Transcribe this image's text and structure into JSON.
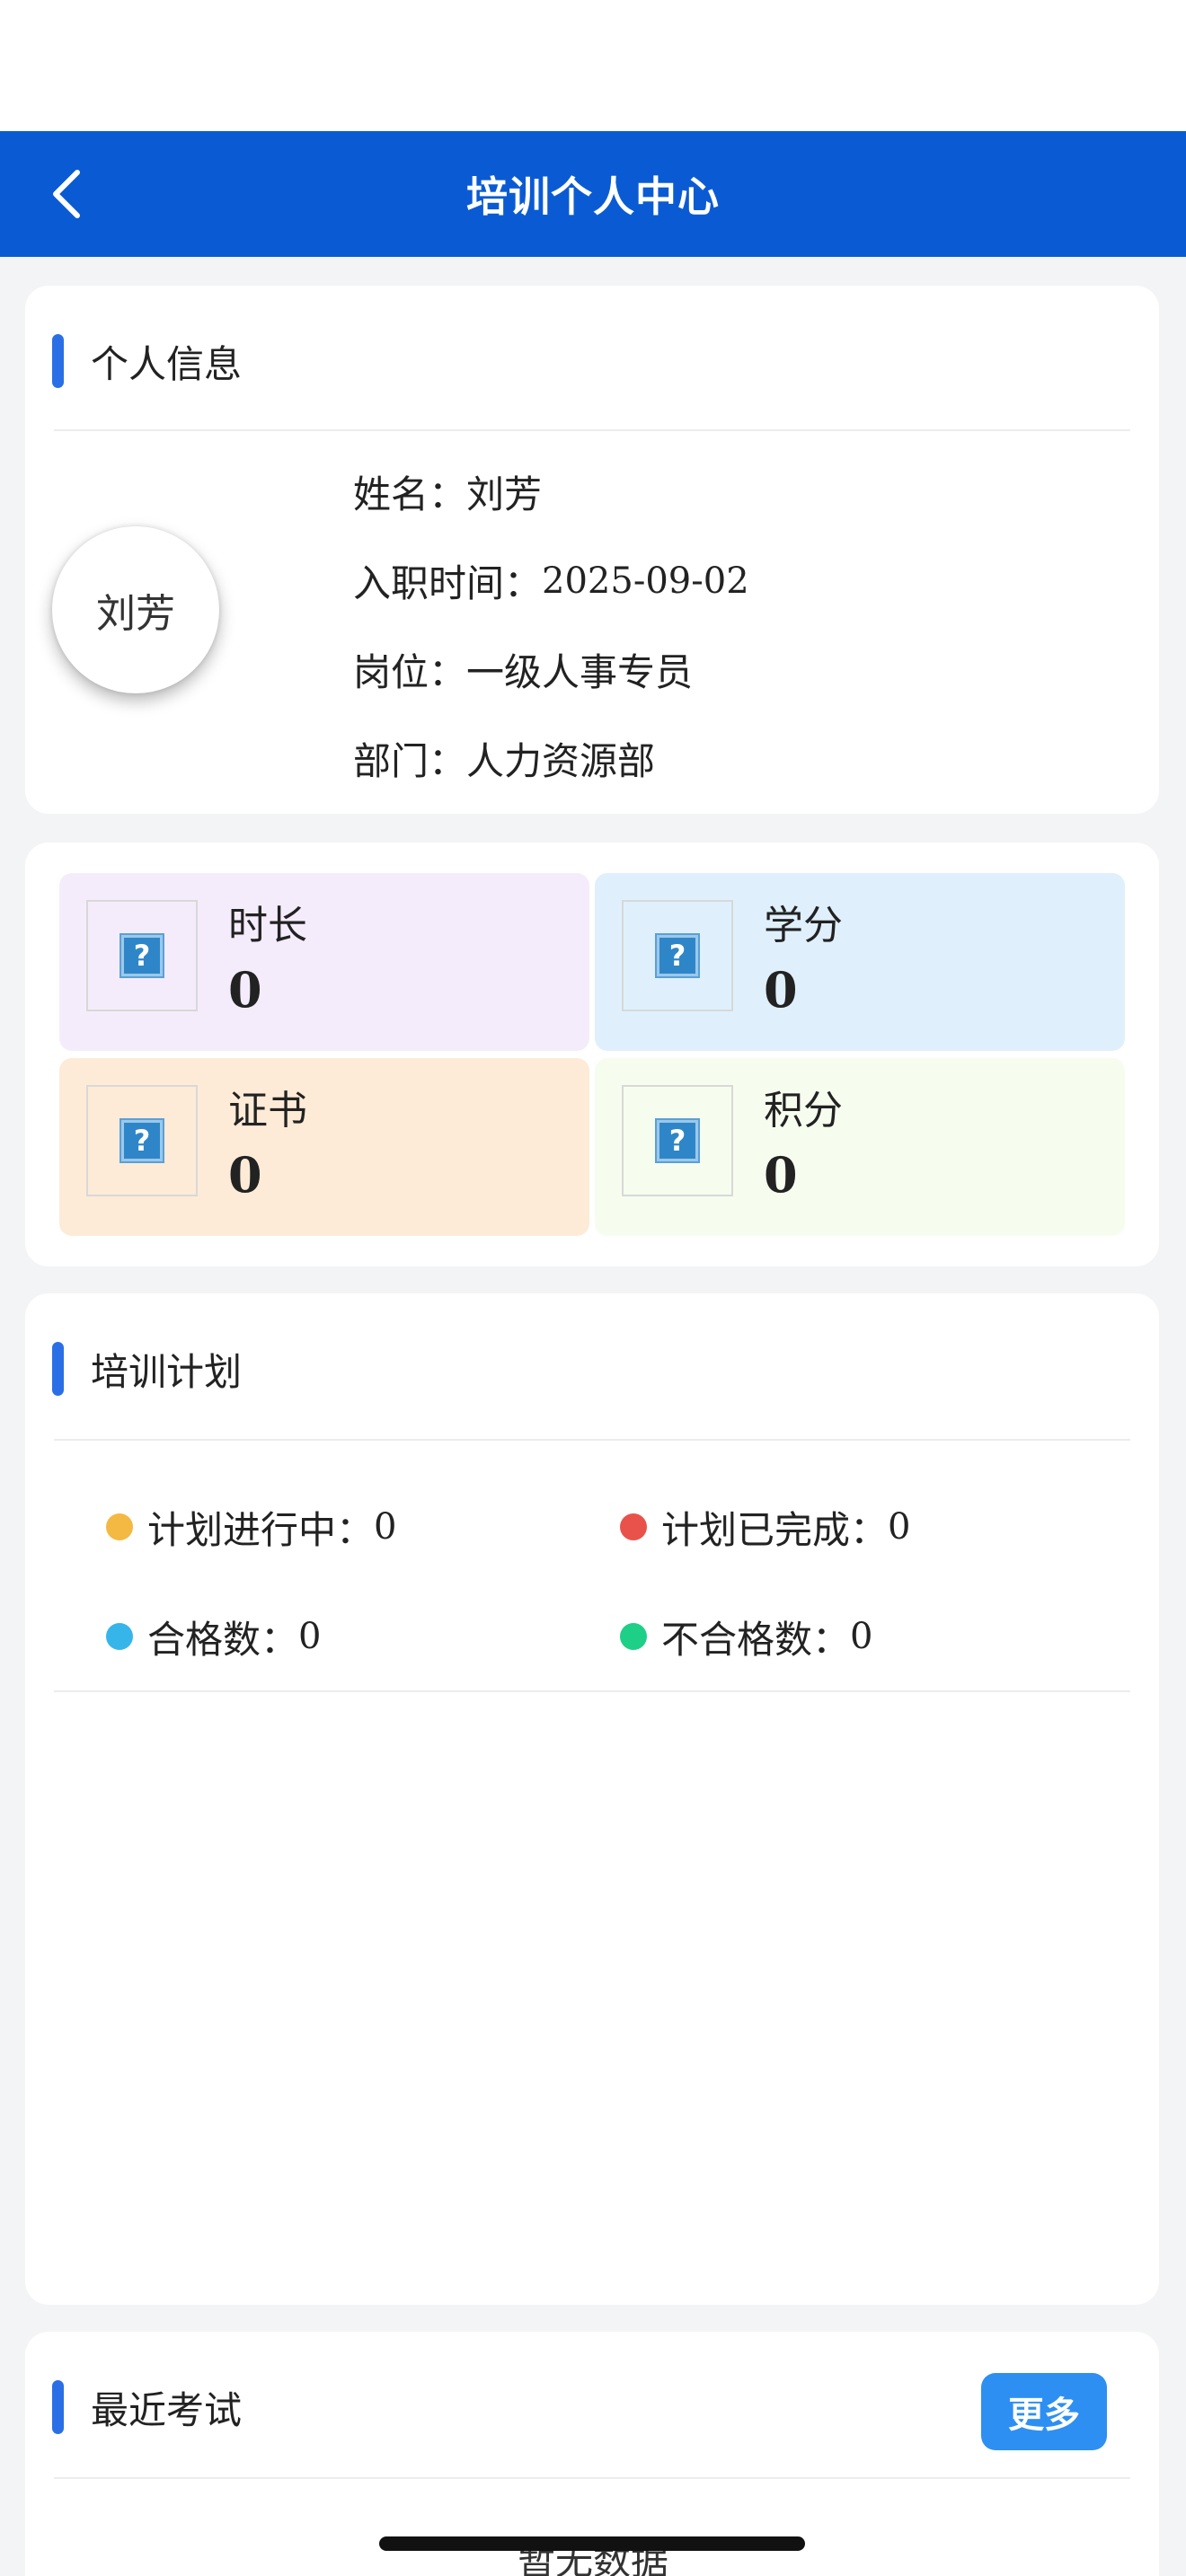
{
  "nav": {
    "title": "培训个人中心",
    "back_icon": "chevron-left-icon"
  },
  "personal_info": {
    "section_title": "个人信息",
    "avatar_text": "刘芳",
    "rows": [
      {
        "label": "姓名：",
        "value": "刘芳"
      },
      {
        "label": "入职时间：",
        "value": "2025-09-02"
      },
      {
        "label": "岗位：",
        "value": "一级人事专员"
      },
      {
        "label": "部门：",
        "value": "人力资源部"
      }
    ]
  },
  "stats": [
    {
      "label": "时长",
      "value": "0",
      "icon": "broken-image-icon",
      "bg": "#f5ecfb",
      "glyph": "?"
    },
    {
      "label": "学分",
      "value": "0",
      "icon": "broken-image-icon",
      "bg": "#dff0fc",
      "glyph": "?"
    },
    {
      "label": "证书",
      "value": "0",
      "icon": "broken-image-icon",
      "bg": "#fdebd7",
      "glyph": "?"
    },
    {
      "label": "积分",
      "value": "0",
      "icon": "broken-image-icon",
      "bg": "#f6fdef",
      "glyph": "?"
    }
  ],
  "training_plan": {
    "section_title": "培训计划",
    "legend": [
      {
        "label": "计划进行中：",
        "value": "0",
        "color": "#f4b942"
      },
      {
        "label": "计划已完成：",
        "value": "0",
        "color": "#e9524a"
      },
      {
        "label": "合格数：",
        "value": "0",
        "color": "#36b5ea"
      },
      {
        "label": "不合格数：",
        "value": "0",
        "color": "#1ecf88"
      }
    ]
  },
  "recent_exams": {
    "section_title": "最近考试",
    "more_label": "更多",
    "empty_text": "暂无数据"
  },
  "colors": {
    "nav_bg": "#0a5bd3",
    "accent_bar": "#2b6fe6",
    "more_button": "#2d8ff2"
  }
}
